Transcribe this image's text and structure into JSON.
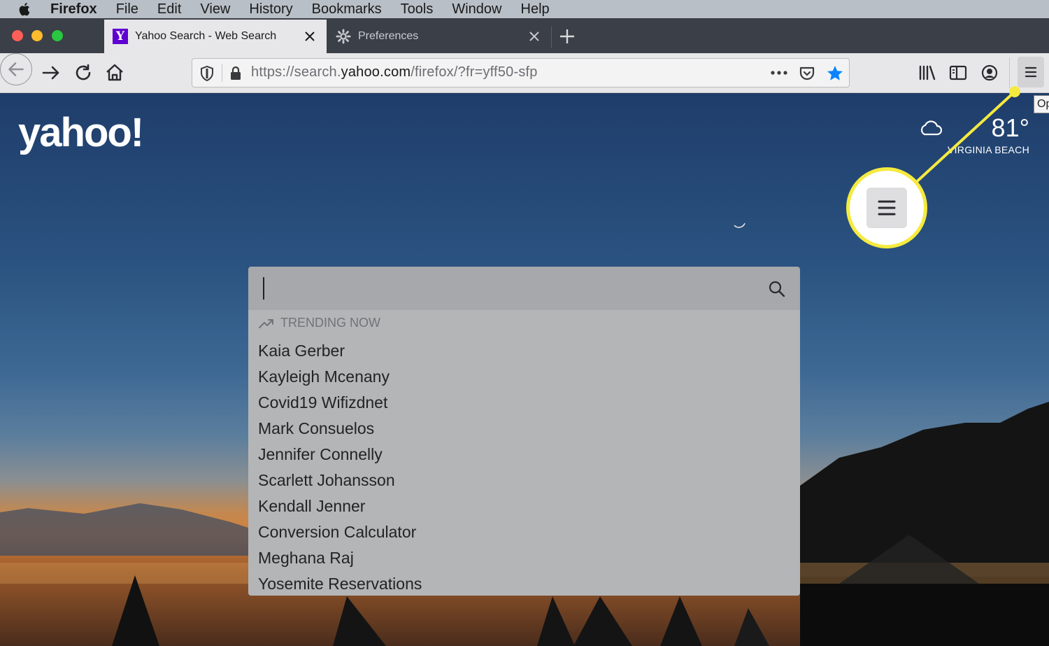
{
  "menubar": {
    "app_name": "Firefox",
    "items": [
      "File",
      "Edit",
      "View",
      "History",
      "Bookmarks",
      "Tools",
      "Window",
      "Help"
    ]
  },
  "tabs": [
    {
      "title": "Yahoo Search - Web Search",
      "favicon": "yahoo-favicon",
      "active": true
    },
    {
      "title": "Preferences",
      "favicon": "gear-icon",
      "active": false
    }
  ],
  "urlbar": {
    "url_prefix": "https://search.",
    "url_domain": "yahoo.com",
    "url_path": "/firefox/?fr=yff50-sfp"
  },
  "page": {
    "logo": "yahoo!",
    "weather": {
      "temperature": "81°",
      "city": "VIRGINIA BEACH"
    },
    "tooltip": "Op",
    "search": {
      "value": ""
    },
    "trending_label": "TRENDING NOW",
    "trending": [
      "Kaia Gerber",
      "Kayleigh Mcenany",
      "Covid19 Wifizdnet",
      "Mark Consuelos",
      "Jennifer Connelly",
      "Scarlett Johansson",
      "Kendall Jenner",
      "Conversion Calculator",
      "Meghana Raj",
      "Yosemite Reservations"
    ]
  },
  "colors": {
    "callout": "#f5ea3f",
    "yahoo_purple": "#5f01d1",
    "bookmark_star": "#0a84ff"
  }
}
